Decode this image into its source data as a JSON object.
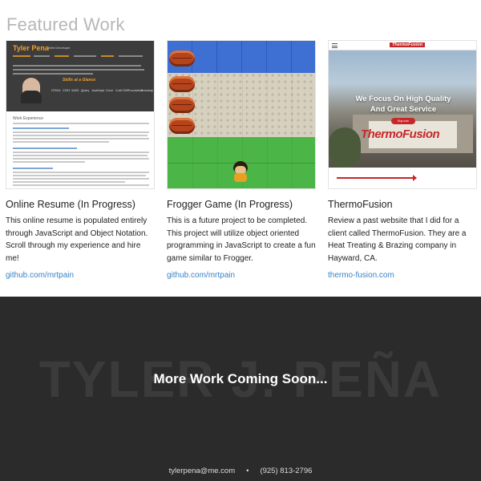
{
  "featured": {
    "title": "Featured Work",
    "projects": [
      {
        "title": "Online Resume (In Progress)",
        "description": "This online resume is populated entirely through JavaScript and Object Notation. Scroll through my experience and hire me!",
        "link": "github.com/mrtpain",
        "thumb": {
          "name": "Tyler Pena",
          "subtitle": "Web Developer",
          "glance": "Skills at a Glance",
          "skills": [
            "HTML5",
            "CSS3",
            "SASS",
            "jQuery",
            "JavaScript",
            "Grunt",
            "Craft CMS",
            "Foundation",
            "Bootstrap"
          ],
          "section": "Work Experience"
        }
      },
      {
        "title": "Frogger Game (In Progress)",
        "description": "This is a future project to be completed. This project will utilize object oriented programming in JavaScript to create a fun game similar to Frogger.",
        "link": "github.com/mrtpain"
      },
      {
        "title": "ThermoFusion",
        "description": "Review a past website that I did for a client called ThermoFusion. They are a Heat Treating & Brazing company in Hayward, CA.",
        "link": "thermo-fusion.com",
        "thumb": {
          "logo": "ThermoFusion",
          "headline1": "We Focus On High Quality",
          "headline2": "And Great Service",
          "button": "Buy now",
          "sign": "ThermoFusion"
        }
      }
    ]
  },
  "band": {
    "background_text": "TYLER J. PEÑA",
    "heading": "More Work Coming Soon...",
    "email": "tylerpena@me.com",
    "separator": "•",
    "phone": "(925) 813-2796"
  },
  "colors": {
    "link": "#3b82c4",
    "band_bg": "#2b2b2b",
    "accent_red": "#c8272a"
  }
}
